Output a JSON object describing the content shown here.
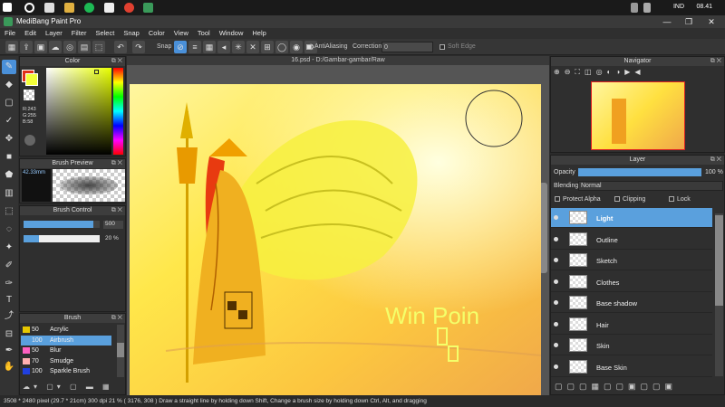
{
  "taskbar": {
    "language": "IND",
    "time": "08.41"
  },
  "window": {
    "title": "MediBang Paint Pro",
    "min": "—",
    "max": "❐",
    "close": "✕"
  },
  "menu": [
    "File",
    "Edit",
    "Layer",
    "Filter",
    "Select",
    "Snap",
    "Color",
    "View",
    "Tool",
    "Window",
    "Help"
  ],
  "toolbar": {
    "snap_label": "Snap",
    "antialiasing_label": "AntiAliasing",
    "correction_label": "Correction",
    "correction_value": "0",
    "soft_edge_label": "Soft Edge"
  },
  "color_panel": {
    "title": "Color",
    "rgb": [
      "R:243",
      "G:255",
      "B:58"
    ],
    "colors": {
      "primary": "#f3ff3a",
      "secondary": "#e23018"
    }
  },
  "brush_preview": {
    "title": "Brush Preview",
    "size": "42.33mm"
  },
  "brush_control": {
    "title": "Brush Control",
    "size_value": "500",
    "opacity_value": "20",
    "opacity_unit": "%",
    "size_fraction": 0.92,
    "opacity_fraction": 0.2
  },
  "brush_panel": {
    "title": "Brush",
    "items": [
      {
        "size": "50",
        "name": "Acrylic",
        "color": "#e8c800"
      },
      {
        "size": "100",
        "name": "Airbrush",
        "color": "#5aa0dd"
      },
      {
        "size": "50",
        "name": "Blur",
        "color": "#ff60c0"
      },
      {
        "size": "70",
        "name": "Smudge",
        "color": "#ffb0b0"
      },
      {
        "size": "100",
        "name": "Sparkle Brush",
        "color": "#2040e0"
      }
    ]
  },
  "document": {
    "tab": "16.psd - D:/Gambar-gambar/Raw"
  },
  "artwork": {
    "signature_text": "Win Poin"
  },
  "navigator": {
    "title": "Navigator"
  },
  "layer_panel": {
    "title": "Layer",
    "opacity_label": "Opacity",
    "opacity_value": "100 %",
    "opacity_fraction": 1.0,
    "blending_label": "Blending",
    "blending_value": "Normal",
    "protect_alpha_label": "Protect Alpha",
    "clipping_label": "Clipping",
    "lock_label": "Lock",
    "layers": [
      "Light",
      "Outline",
      "Sketch",
      "Clothes",
      "Base shadow",
      "Hair",
      "Skin",
      "Base Skin"
    ]
  },
  "status": "3508 * 2480 pixel   (29.7 * 21cm)   300 dpi   21 %   ( 3176, 308 )   Draw a straight line by holding down Shift, Change a brush size by holding down Ctrl, Alt, and dragging"
}
